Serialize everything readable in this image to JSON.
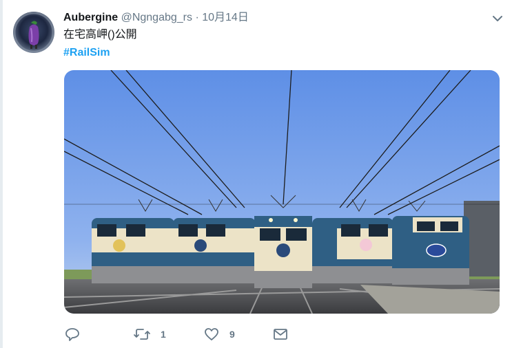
{
  "tweet": {
    "author_name": "Aubergine",
    "author_handle": "@Ngngabg_rs",
    "separator": "·",
    "timestamp": "10月14日",
    "text": "在宅高岬()公開",
    "hashtag": "#RailSim"
  },
  "actions": {
    "reply_count": "",
    "retweet_count": "1",
    "like_count": "9"
  },
  "icons": {
    "menu": "chevron-down-icon",
    "reply": "reply-icon",
    "retweet": "retweet-icon",
    "like": "heart-icon",
    "message": "envelope-icon"
  },
  "colors": {
    "link": "#1da1f2",
    "secondary_text": "#657786",
    "primary_text": "#14171a"
  }
}
